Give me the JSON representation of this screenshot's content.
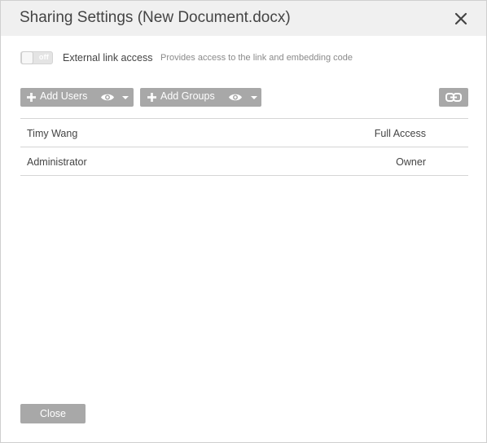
{
  "dialog": {
    "title": "Sharing Settings (New Document.docx)",
    "close_icon": "close-icon"
  },
  "external_link": {
    "toggle_state": "off",
    "label": "External link access",
    "description": "Provides access to the link and embedding code"
  },
  "toolbar": {
    "add_users_label": "Add Users",
    "add_groups_label": "Add Groups",
    "icons": {
      "plus": "plus-icon",
      "eye": "eye-icon",
      "caret": "caret-down-icon",
      "link": "link-icon"
    }
  },
  "shares": [
    {
      "name": "Timy Wang",
      "access": "Full Access"
    },
    {
      "name": "Administrator",
      "access": "Owner"
    }
  ],
  "footer": {
    "close_label": "Close"
  },
  "colors": {
    "header_bg": "#f0f0f0",
    "button_bg": "#a8a8a8",
    "text": "#444444",
    "muted_text": "#8a8a8a",
    "divider": "#d5d5d5"
  }
}
